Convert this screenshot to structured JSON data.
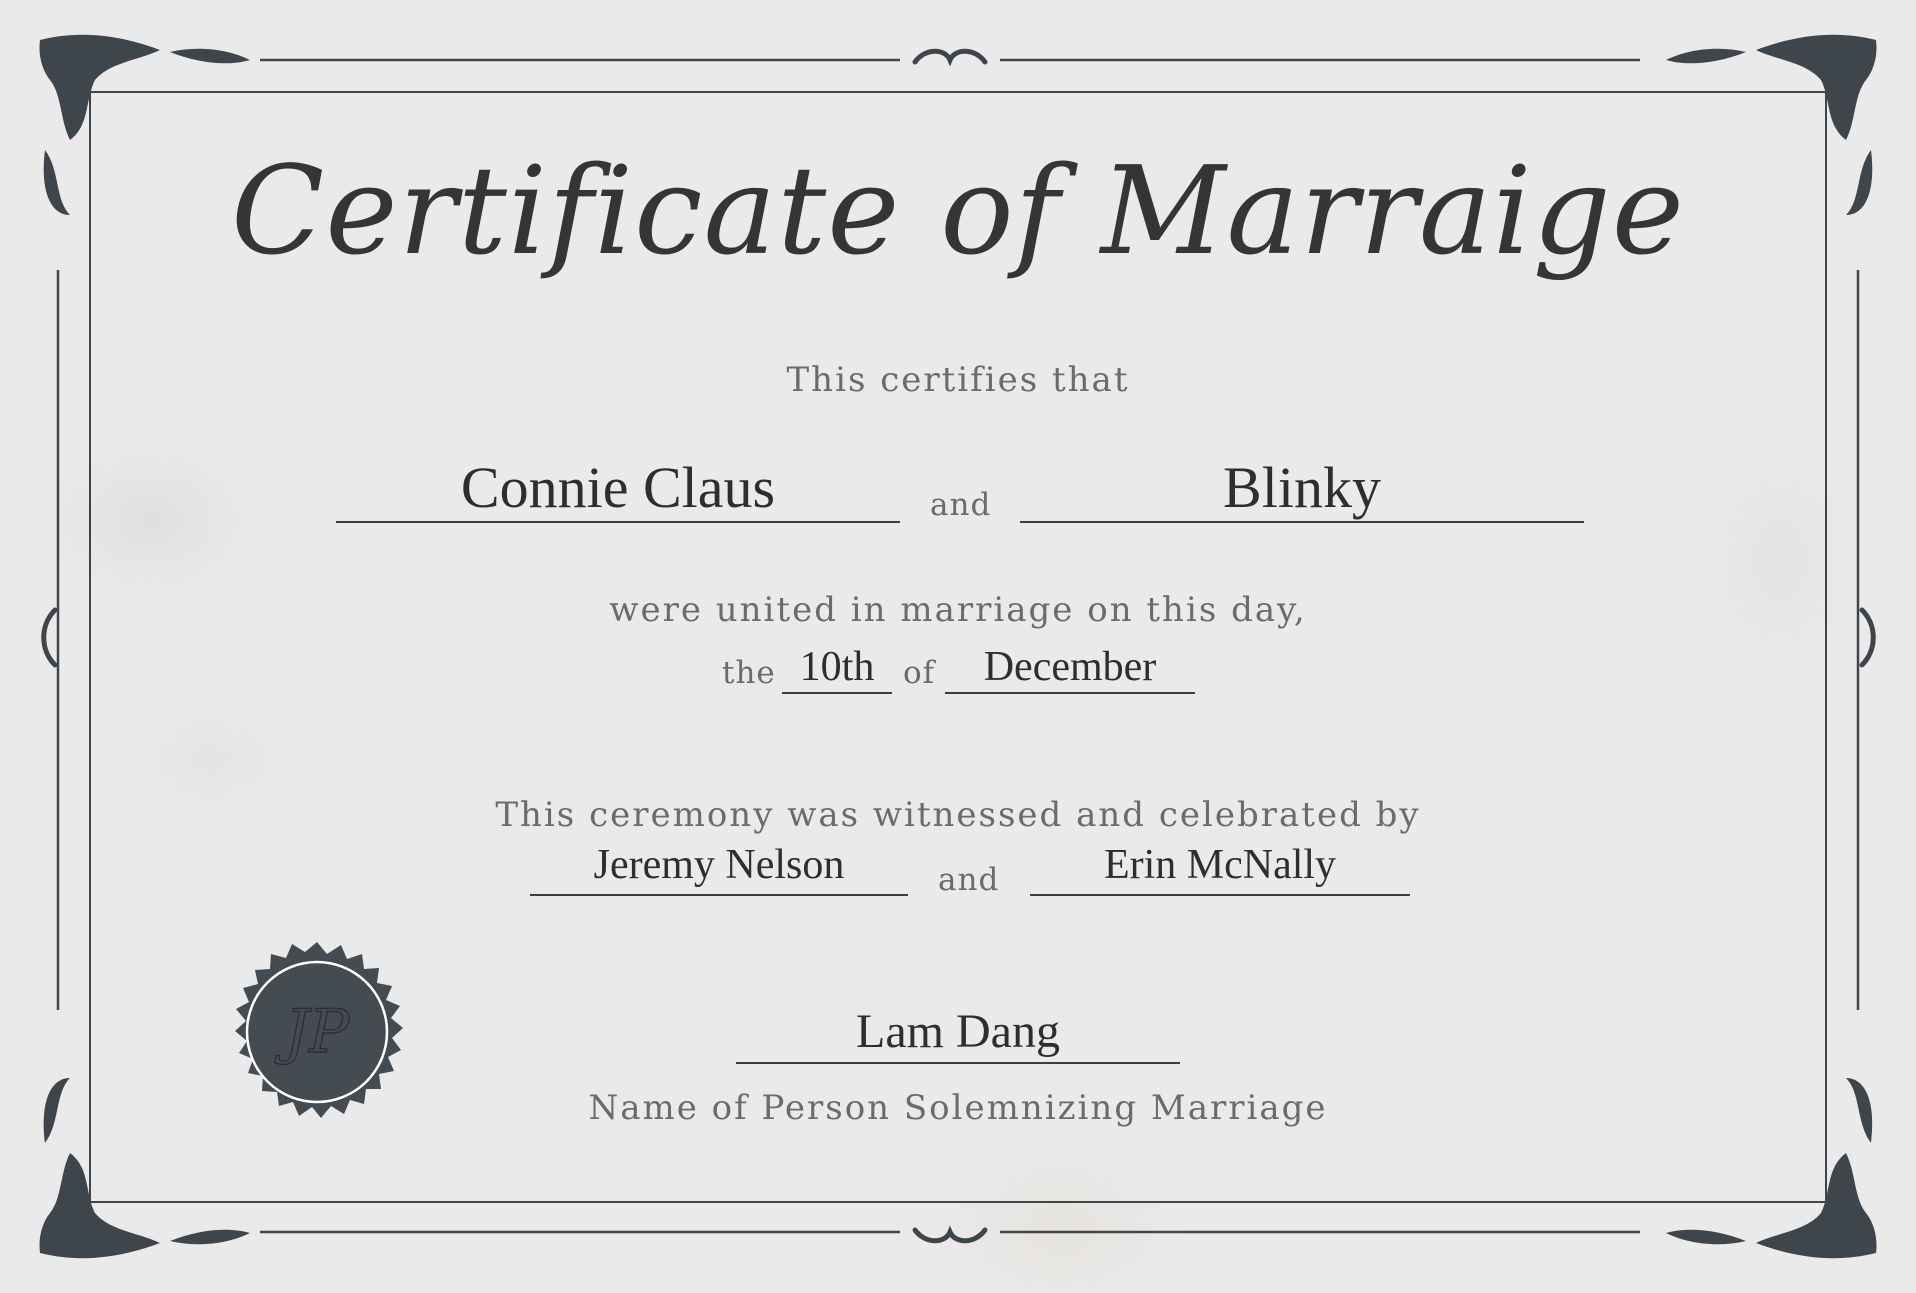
{
  "certificate": {
    "title": "Certificate of Marraige",
    "intro": "This certifies that",
    "partner_one": "Connie Claus",
    "conjunction": "and",
    "partner_two": "Blinky",
    "united_line": "were united in marriage on this day,",
    "the_word": "the",
    "day": "10th",
    "of_word": "of",
    "month": "December",
    "witness_line": "This ceremony was witnessed and celebrated by",
    "witness_one": "Jeremy Nelson",
    "witness_two": "Erin McNally",
    "officiant": "Lam Dang",
    "officiant_caption": "Name of Person Solemnizing Marriage",
    "seal_monogram": "JP"
  },
  "colors": {
    "background": "#ebeaea",
    "border": "#3f464b",
    "seal": "#454c51",
    "text": "#3a3a3a"
  }
}
